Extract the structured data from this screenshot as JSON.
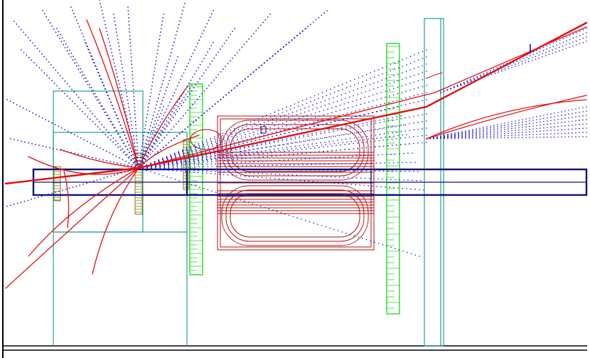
{
  "view": {
    "background": "#ffffff",
    "colors": {
      "frame": "#000000",
      "beam_pipe": "#10107a",
      "structure": "#2a9a9a",
      "tracker_planes": "#22dd22",
      "magnet": "#b01010",
      "tracks": "#e01010",
      "hits": "#1a1ad0",
      "detector_blocks": "#8a7a10"
    },
    "icons": [
      "magnet-coil-icon",
      "tracking-station-icon",
      "beam-pipe-icon"
    ]
  }
}
